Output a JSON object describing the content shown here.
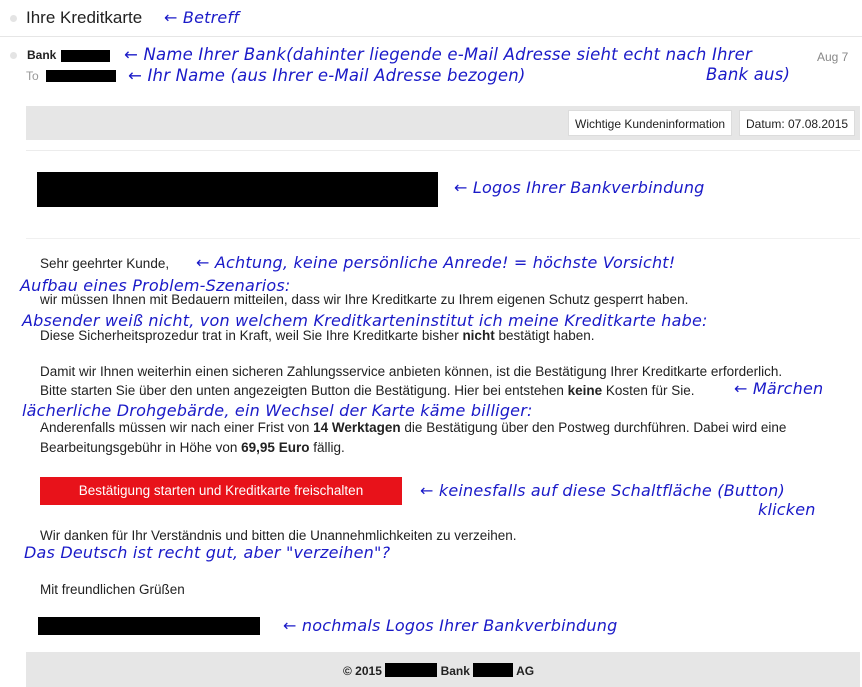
{
  "subject": {
    "title": "Ihre Kreditkarte",
    "annotation": "← Betreff"
  },
  "sender": {
    "label": "Bank",
    "to_label": "To",
    "date": "Aug 7",
    "annotation_name_1": "← Name Ihrer Bank(dahinter liegende e-Mail Adresse sieht echt nach Ihrer",
    "annotation_name_2": "Bank aus)",
    "annotation_to": "← Ihr Name (aus Ihrer e-Mail Adresse bezogen)"
  },
  "mail_header": {
    "info": "Wichtige Kundeninformation",
    "date": "Datum: 07.08.2015"
  },
  "logo_annotation": "← Logos Ihrer Bankverbindung",
  "body": {
    "greeting": "Sehr geehrter Kunde,",
    "greeting_annotation": "← Achtung, keine persönliche Anrede!  = höchste Vorsicht!",
    "scenario_annotation": "Aufbau eines Problem-Szenarios:",
    "line1": "wir müssen Ihnen mit Bedauern mitteilen, dass wir Ihre Kreditkarte zu Ihrem eigenen Schutz gesperrt haben.",
    "sender_annotation": "Absender weiß nicht, von welchem Kreditkarteninstitut ich meine Kreditkarte habe:",
    "line2a": "Diese Sicherheitsprozedur trat in Kraft, weil Sie Ihre Kreditkarte bisher ",
    "line2b": "nicht",
    "line2c": " bestätigt haben.",
    "line3": "Damit wir Ihnen weiterhin einen sicheren Zahlungsservice anbieten können, ist die Bestätigung Ihrer Kreditkarte erforderlich.",
    "line4a": "Bitte starten Sie über den unten angezeigten Button die Bestätigung. Hier bei entstehen ",
    "line4b": "keine",
    "line4c": " Kosten für Sie.",
    "maerchen_annotation": "← Märchen",
    "threat_annotation": "lächerliche Drohgebärde, ein Wechsel der Karte käme billiger:",
    "line5a": "Anderenfalls müssen wir nach einer Frist von ",
    "line5b": "14 Werktagen",
    "line5c": " die Bestätigung über den Postweg durchführen. Dabei wird eine",
    "line6a": "Bearbeitungsgebühr in Höhe von ",
    "line6b": "69,95 Euro",
    "line6c": " fällig.",
    "button_label": "Bestätigung starten und Kreditkarte freischalten",
    "button_annotation_1": "← keinesfalls auf diese Schaltfläche (Button)",
    "button_annotation_2": "klicken",
    "thanks": "Wir danken für Ihr Verständnis und bitten die Unannehmlichkeiten zu verzeihen.",
    "german_annotation": "Das Deutsch ist recht gut, aber \"verzeihen\"?",
    "closing": "Mit freundlichen Grüßen",
    "logo2_annotation": "← nochmals Logos Ihrer Bankverbindung"
  },
  "footer": {
    "prefix": "© 2015",
    "middle": "Bank",
    "suffix": "AG"
  }
}
